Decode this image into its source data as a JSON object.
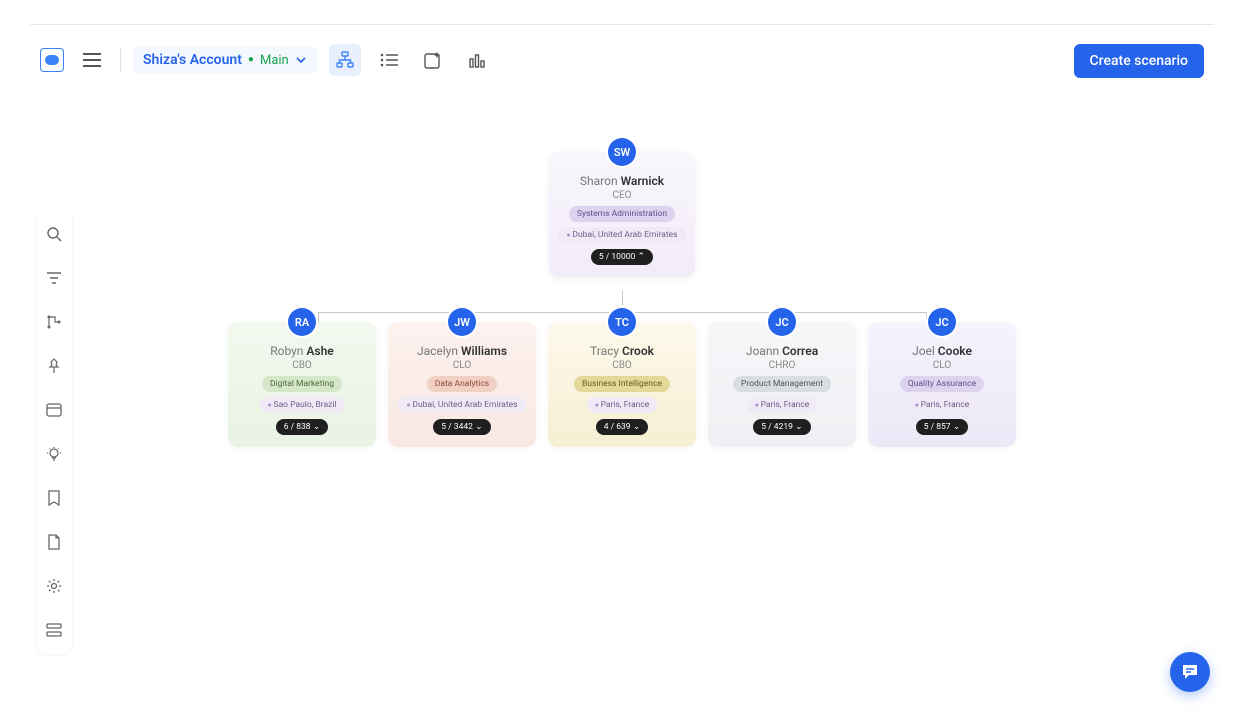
{
  "topbar": {
    "account_name": "Shiza's Account",
    "branch": "Main"
  },
  "create_button": "Create scenario",
  "root": {
    "initials": "SW",
    "first": "Sharon",
    "last": "Warnick",
    "title": "CEO",
    "department": "Systems Administration",
    "location": "Dubai, United Arab Emirates",
    "counts": "5 / 10000"
  },
  "children": [
    {
      "initials": "RA",
      "first": "Robyn",
      "last": "Ashe",
      "title": "CBO",
      "department": "Digital Marketing",
      "location": "Sao Paulo, Brazil",
      "counts": "6 / 838"
    },
    {
      "initials": "JW",
      "first": "Jacelyn",
      "last": "Williams",
      "title": "CLO",
      "department": "Data Analytics",
      "location": "Dubai, United Arab Emirates",
      "counts": "5 / 3442"
    },
    {
      "initials": "TC",
      "first": "Tracy",
      "last": "Crook",
      "title": "CBO",
      "department": "Business Intelligence",
      "location": "Paris, France",
      "counts": "4 / 639"
    },
    {
      "initials": "JC",
      "first": "Joann",
      "last": "Correa",
      "title": "CHRO",
      "department": "Product Management",
      "location": "Paris, France",
      "counts": "5 / 4219"
    },
    {
      "initials": "JC",
      "first": "Joel",
      "last": "Cooke",
      "title": "CLO",
      "department": "Quality Assurance",
      "location": "Paris, France",
      "counts": "5 / 857"
    }
  ]
}
